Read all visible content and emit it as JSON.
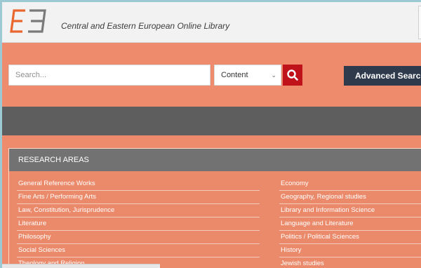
{
  "header": {
    "logo_text": "CE",
    "site_title": "Central and Eastern European Online Library"
  },
  "search": {
    "placeholder": "Search...",
    "scope_selected": "Content",
    "search_icon": "search-icon",
    "advanced_label": "Advanced Search"
  },
  "research_areas": {
    "heading": "RESEARCH AREAS",
    "left_items": [
      "General Reference Works",
      "Fine Arts / Performing Arts",
      "Law, Constitution, Jurisprudence",
      "Literature",
      "Philosophy",
      "Social Sciences",
      "Theology and Religion"
    ],
    "right_items": [
      "Economy",
      "Geography, Regional studies",
      "Library and Information Science",
      "Language and Literature",
      "Politics / Political Sciences",
      "History",
      "Jewish studies"
    ]
  },
  "colors": {
    "brand_orange": "#ed8b6c",
    "search_red": "#c0121a",
    "navy": "#2f3a4d",
    "band_gray": "#5e5e5e"
  }
}
